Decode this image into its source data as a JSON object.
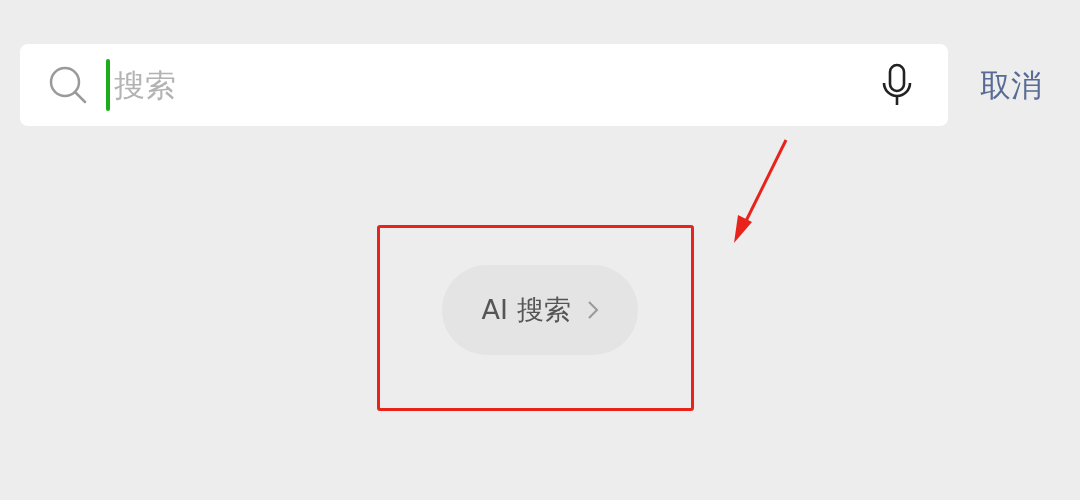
{
  "search": {
    "placeholder": "搜索",
    "focused": true
  },
  "cancel": "取消",
  "ai_search": {
    "label": "AI 搜索"
  }
}
